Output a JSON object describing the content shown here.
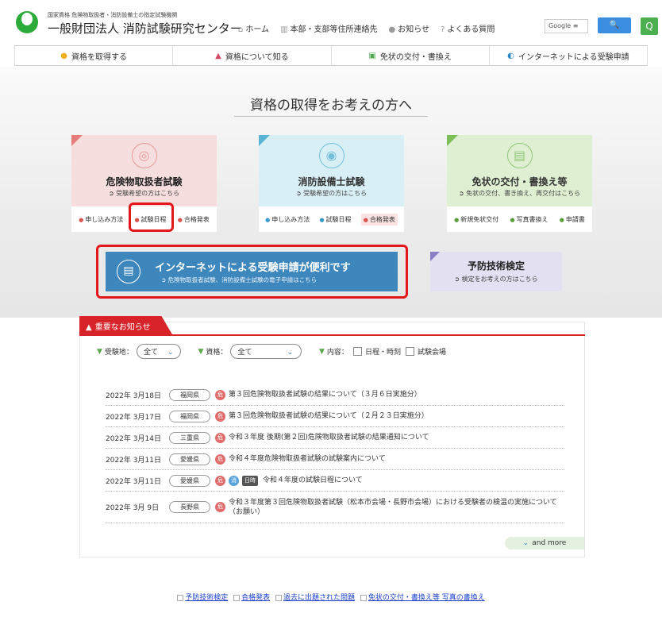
{
  "header": {
    "org_sub": "国家資格 危険物取扱者・消防設備士の指定試験機関",
    "org_name": "一般財団法人 消防試験研究センター",
    "nav": [
      {
        "icon": "home-icon",
        "label": "ホーム"
      },
      {
        "icon": "building-icon",
        "label": "本部・支部等住所連絡先"
      },
      {
        "icon": "info-icon",
        "label": "お知らせ"
      },
      {
        "icon": "question-icon",
        "label": "よくある質問"
      }
    ],
    "search_placeholder": "Google ≡",
    "search_button": "🔍"
  },
  "main_nav": [
    {
      "icon": "hand-icon",
      "label": "資格を取得する"
    },
    {
      "icon": "people-icon",
      "label": "資格について知る"
    },
    {
      "icon": "card-icon",
      "label": "免状の交付・書換え"
    },
    {
      "icon": "globe-icon",
      "label": "インターネットによる受験申請"
    }
  ],
  "hero": {
    "title": "資格の取得をお考えの方へ",
    "cards": [
      {
        "title": "危険物取扱者試験",
        "sub": "受験希望の方はこちら",
        "links": [
          "申し込み方法",
          "試験日程",
          "合格発表"
        ]
      },
      {
        "title": "消防設備士試験",
        "sub": "受験希望の方はこちら",
        "links": [
          "申し込み方法",
          "試験日程",
          "合格発表"
        ]
      },
      {
        "title": "免状の交付・書換え等",
        "sub": "免状の交付、書き換え、再交付はこちら",
        "links": [
          "新規免状交付",
          "写真書換え",
          "申請書"
        ]
      }
    ],
    "internet": {
      "title": "インターネットによる受験申請が便利です",
      "sub": "危険物取扱者試験、消防設備士試験の電子申請はこちら"
    },
    "yobo": {
      "title": "予防技術検定",
      "sub": "検定をお考えの方はこちら"
    }
  },
  "notice": {
    "tab": "重要なお知らせ",
    "filters": {
      "place_label": "受験地：",
      "place_value": "全て",
      "qual_label": "資格：",
      "qual_value": "全て",
      "content_label": "内容：",
      "chk1": "日程・時刻",
      "chk2": "試験会場"
    },
    "items": [
      {
        "date": "2022年 3月18日",
        "pref": "福岡県",
        "tag": "危",
        "text": "第３回危険物取扱者試験の結果について（３月６日実施分）"
      },
      {
        "date": "2022年 3月17日",
        "pref": "福岡県",
        "tag": "危",
        "text": "第３回危険物取扱者試験の結果について（２月２３日実施分）"
      },
      {
        "date": "2022年 3月14日",
        "pref": "三重県",
        "tag": "危",
        "text": "令和３年度 後期(第２回)危険物取扱者試験の結果通知について"
      },
      {
        "date": "2022年 3月11日",
        "pref": "愛媛県",
        "tag": "危",
        "text": "令和４年度危険物取扱者試験の試験案内について"
      },
      {
        "date": "2022年 3月11日",
        "pref": "愛媛県",
        "tag": "危",
        "tag2": "消",
        "tag3": "日時",
        "text": "令和４年度の試験日程について"
      },
      {
        "date": "2022年 3月 9日",
        "pref": "長野県",
        "tag": "危",
        "text": "令和３年度第３回危険物取扱者試験（松本市会場・長野市会場）における受験者の検温の実施について（お願い）"
      }
    ],
    "more": "and more"
  },
  "footer": {
    "links": [
      "予防技術検定",
      "合格発表",
      "過去に出題された問題",
      "免状の交付・書換え等 写真の書換え"
    ]
  }
}
